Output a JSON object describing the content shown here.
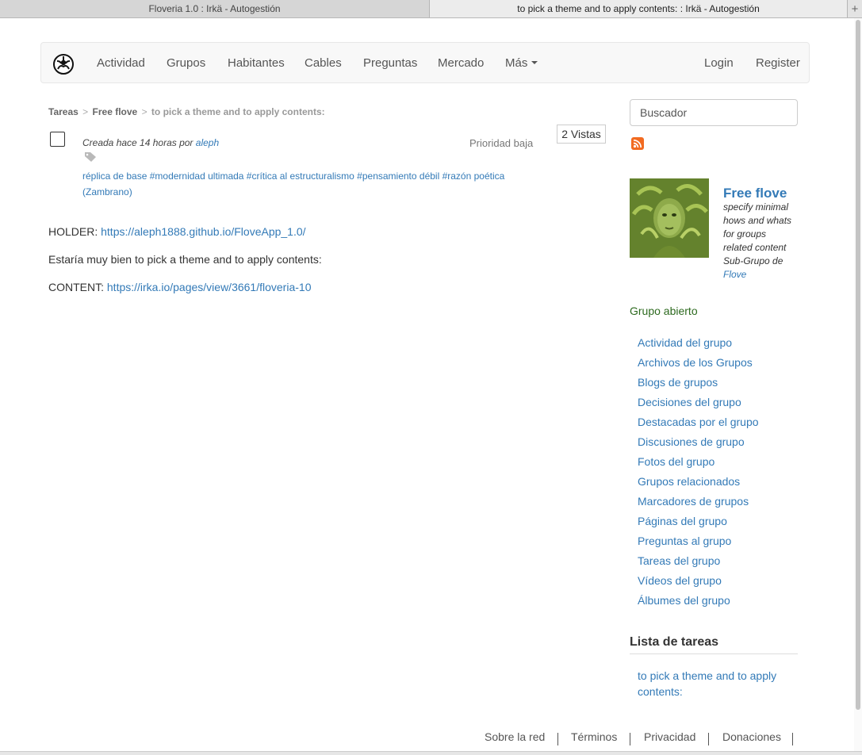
{
  "browser": {
    "tabs": [
      {
        "label": "Floveria 1.0 : Irkä - Autogestión"
      },
      {
        "label": "to pick a theme and to apply contents: : Irkä - Autogestión"
      }
    ],
    "new_tab": "+"
  },
  "navbar": {
    "items": [
      "Actividad",
      "Grupos",
      "Habitantes",
      "Cables",
      "Preguntas",
      "Mercado",
      "Más"
    ],
    "login": "Login",
    "register": "Register"
  },
  "breadcrumb": {
    "root": "Tareas",
    "sep": ">",
    "group": "Free flove",
    "current": "to pick a theme and to apply contents:"
  },
  "task": {
    "created_prefix": "Creada hace 14 horas por",
    "author": "aleph",
    "priority": "Prioridad baja",
    "views": "2 Vistas",
    "tags": "réplica de base #modernidad ultimada #crítica al estructuralismo #pensamiento débil #razón poética (Zambrano)",
    "holder_label": "HOLDER:",
    "holder_url": "https://aleph1888.github.io/FloveApp_1.0/",
    "sentence": "Estaría muy bien to pick a theme and to apply contents:",
    "content_label": "CONTENT:",
    "content_url": "https://irka.io/pages/view/3661/floveria-10"
  },
  "sidebar": {
    "search_placeholder": "Buscador",
    "group": {
      "name": "Free flove",
      "description": "specify minimal hows and whats for groups related content",
      "subgroup_prefix": "Sub-Grupo de",
      "parent": "Flove",
      "status": "Grupo abierto"
    },
    "menu": [
      "Actividad del grupo",
      "Archivos de los Grupos",
      "Blogs de grupos",
      "Decisiones del grupo",
      "Destacadas por el grupo",
      "Discusiones de grupo",
      "Fotos del grupo",
      "Grupos relacionados",
      "Marcadores de grupos",
      "Páginas del grupo",
      "Preguntas al grupo",
      "Tareas del grupo",
      "Vídeos del grupo",
      "Álbumes del grupo"
    ],
    "task_list_title": "Lista de tareas",
    "task_list_item": "to pick a theme and to apply contents:"
  },
  "footer": {
    "links": [
      "Sobre la red",
      "Términos",
      "Privacidad",
      "Donaciones"
    ]
  }
}
